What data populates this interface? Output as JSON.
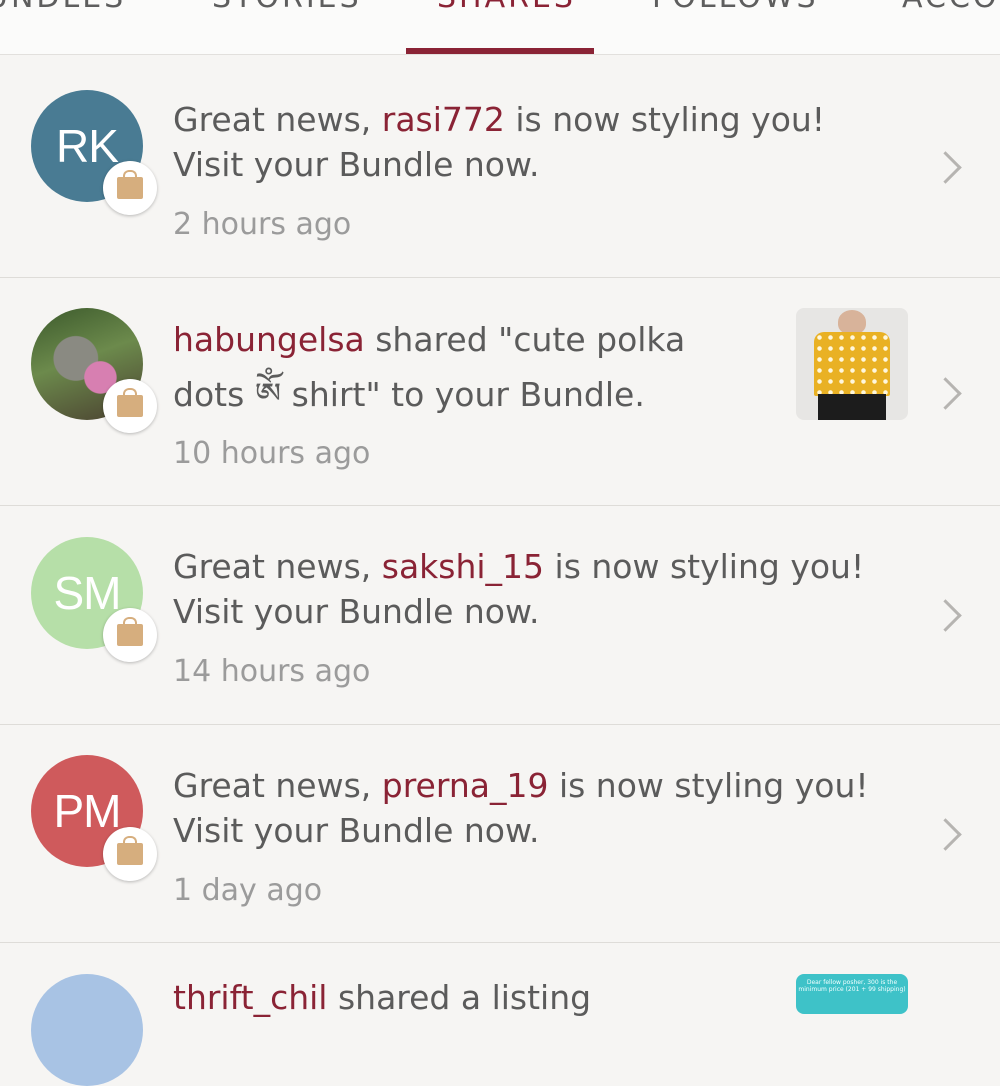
{
  "tabs": [
    {
      "label": "UNDLES"
    },
    {
      "label": "STORIES"
    },
    {
      "label": "SHARES"
    },
    {
      "label": "FOLLOWS"
    },
    {
      "label": "ACCO"
    }
  ],
  "colors": {
    "accent": "#8a2335",
    "background": "#f6f5f3"
  },
  "notifications": [
    {
      "avatar_initials": "RK",
      "avatar_color": "#497b93",
      "prefix": "Great news, ",
      "username": "rasi772",
      "suffix": " is now styling you!",
      "line2": "Visit your Bundle now.",
      "time": "2 hours ago"
    },
    {
      "username": "habungelsa",
      "line1_rest": " shared \"cute polka",
      "line2": "dots ༀ shirt\" to your Bundle.",
      "time": "10 hours ago"
    },
    {
      "avatar_initials": "SM",
      "avatar_color": "#b6dfa8",
      "prefix": "Great news, ",
      "username": "sakshi_15",
      "suffix": " is now styling you!",
      "line2": "Visit your Bundle now.",
      "time": "14 hours ago"
    },
    {
      "avatar_initials": "PM",
      "avatar_color": "#cf5a5c",
      "prefix": "Great news, ",
      "username": "prerna_19",
      "suffix": " is now styling you!",
      "line2": "Visit your Bundle now.",
      "time": "1 day ago"
    },
    {
      "username": "thrift_chil",
      "line1_rest": " shared a listing",
      "thumb_text": "Dear fellow posher, 300 is the minimum price (201 + 99 shipping)"
    }
  ],
  "icons": {
    "badge": "shopping-bag-icon",
    "chevron": "chevron-right-icon"
  }
}
